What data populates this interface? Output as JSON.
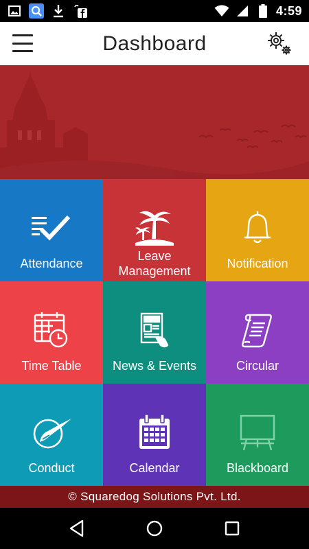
{
  "status_bar": {
    "time": "4:59",
    "left_icons": [
      "image-icon",
      "search-icon",
      "download-icon",
      "facebook-icon"
    ],
    "right_icons": [
      "wifi-icon",
      "signal-icon",
      "battery-icon"
    ]
  },
  "header": {
    "title": "Dashboard",
    "menu_icon": "hamburger-menu-icon",
    "settings_icon": "settings-gears-icon"
  },
  "tiles": [
    {
      "label": "Attendance",
      "icon": "checklist-icon",
      "color": "#1779c5"
    },
    {
      "label": "Leave\nManagement",
      "icon": "palm-island-icon",
      "color": "#c83338"
    },
    {
      "label": "Notification",
      "icon": "bell-icon",
      "color": "#e6a512"
    },
    {
      "label": "Time Table",
      "icon": "calendar-clock-icon",
      "color": "#ec4248"
    },
    {
      "label": "News & Events",
      "icon": "newspaper-icon",
      "color": "#0e8e7e"
    },
    {
      "label": "Circular",
      "icon": "scroll-icon",
      "color": "#8c3fc2"
    },
    {
      "label": "Conduct",
      "icon": "conduct-badge-icon",
      "color": "#0e9bb5"
    },
    {
      "label": "Calendar",
      "icon": "calendar-icon",
      "color": "#5f33b6"
    },
    {
      "label": "Blackboard",
      "icon": "blackboard-icon",
      "color": "#1d9a5c"
    }
  ],
  "colors": {
    "banner": "#a8272b",
    "footer": "#7b1517"
  },
  "footer": {
    "text": "© Squaredog Solutions Pvt. Ltd."
  },
  "nav_bar": {
    "icons": [
      "back-icon",
      "home-icon",
      "recents-icon"
    ]
  }
}
